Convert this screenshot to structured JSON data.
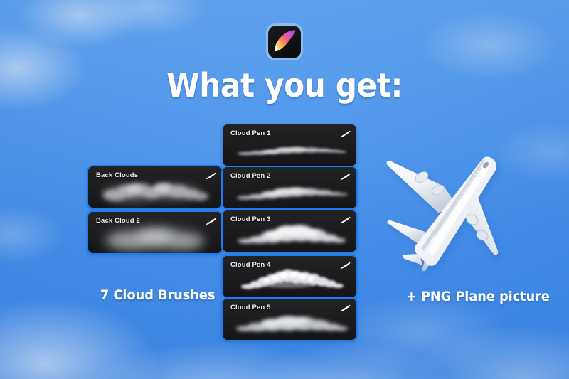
{
  "page": {
    "background_color": "#4a95ec",
    "accent_color": "#1a7df0",
    "card_color": "#1c1c1e"
  },
  "logo": {
    "name": "procreate-app-icon",
    "alt": "Procreate"
  },
  "heading": {
    "text": "What you get:"
  },
  "brushes": {
    "left_column": [
      {
        "label": "Back Clouds",
        "icon": "brush-stroke-icon",
        "selected": true
      },
      {
        "label": "Back Cloud 2",
        "icon": "brush-stroke-icon",
        "selected": true
      }
    ],
    "right_column": [
      {
        "label": "Cloud Pen 1",
        "icon": "brush-stroke-icon",
        "selected": false
      },
      {
        "label": "Cloud Pen 2",
        "icon": "brush-stroke-icon",
        "selected": true
      },
      {
        "label": "Cloud Pen 3",
        "icon": "brush-stroke-icon",
        "selected": true
      },
      {
        "label": "Cloud Pen 4",
        "icon": "brush-stroke-icon",
        "selected": true
      },
      {
        "label": "Cloud Pen 5",
        "icon": "brush-stroke-icon",
        "selected": true
      }
    ]
  },
  "captions": {
    "left": "7 Cloud Brushes",
    "right": "+ PNG Plane picture"
  },
  "plane": {
    "name": "airplane-photo",
    "alt": "White passenger airplane"
  }
}
